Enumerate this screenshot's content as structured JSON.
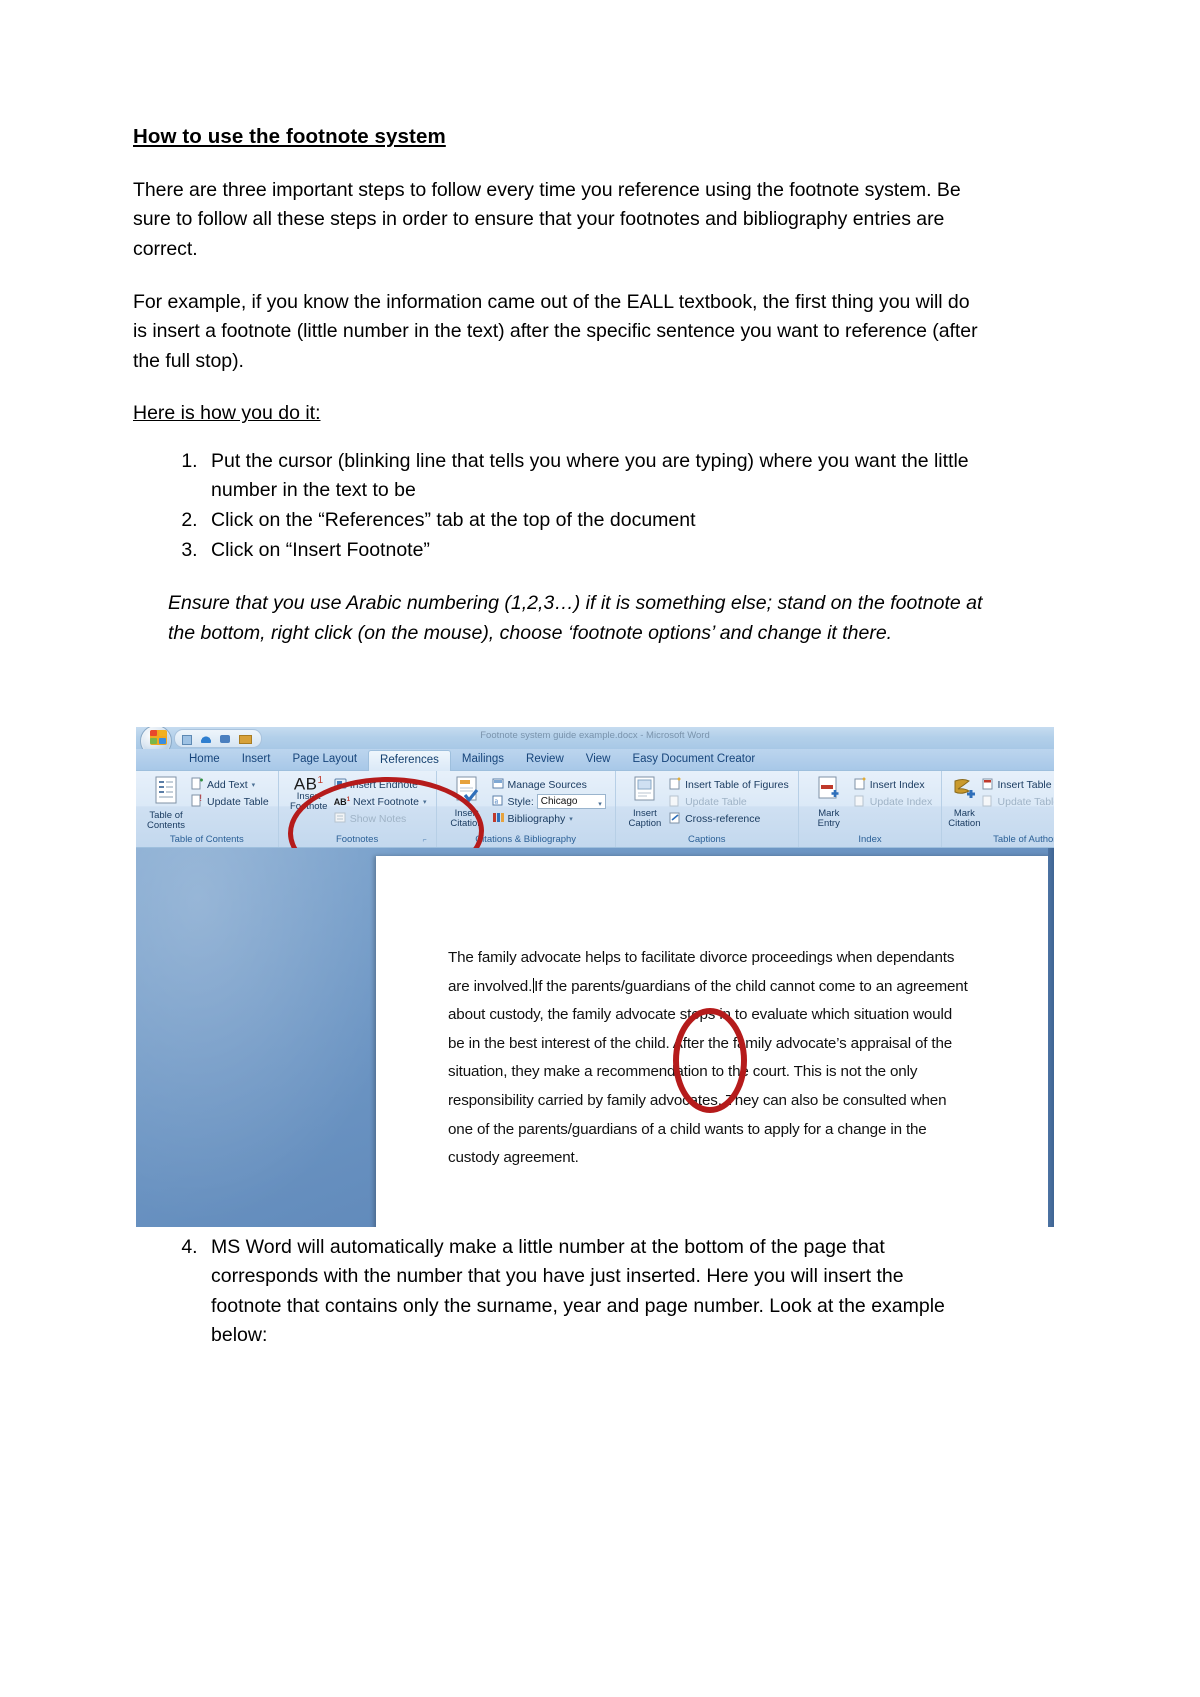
{
  "document": {
    "title": "How to use the footnote system",
    "paragraphs": [
      "There are three important steps to follow every time you reference using the footnote system. Be sure to follow all these steps in order to ensure that your footnotes and bibliography entries are correct.",
      "For example, if you know the information came out of the EALL textbook, the first thing you will do is insert a footnote (little number in the text) after the specific sentence you want to reference (after the full stop)."
    ],
    "lead_in": "Here is how you do it:",
    "steps": [
      "Put the cursor (blinking line that tells you where you are typing) where you want the little number in the text to be",
      "Click on the “References” tab at the top of the document",
      "Click on “Insert Footnote”"
    ],
    "italic_note": "Ensure that you use Arabic numbering (1,2,3…) if it is something else; stand on the footnote at the bottom, right click (on the mouse), choose ‘footnote options’ and change it there.",
    "steps_continued": [
      "MS Word will automatically make a little number at the bottom of the page that corresponds with the number that you have just inserted. Here you will insert the footnote that contains only the surname, year and page number. Look at the example below:"
    ]
  },
  "screenshot": {
    "window_title": "Footnote system guide example.docx - Microsoft Word",
    "office_button": "Office Button",
    "quick_access": [
      "save-icon",
      "undo-icon",
      "redo-icon",
      "customize-icon"
    ],
    "tabs": [
      {
        "label": "Home",
        "active": false
      },
      {
        "label": "Insert",
        "active": false
      },
      {
        "label": "Page Layout",
        "active": false
      },
      {
        "label": "References",
        "active": true
      },
      {
        "label": "Mailings",
        "active": false
      },
      {
        "label": "Review",
        "active": false
      },
      {
        "label": "View",
        "active": false
      },
      {
        "label": "Easy Document Creator",
        "active": false
      }
    ],
    "ribbon_groups": [
      {
        "label": "Table of Contents",
        "big_button": "Table of\nContents",
        "big_button_line1": "Table of",
        "big_button_line2": "Contents",
        "big_icon": "table-of-contents-icon",
        "items": [
          {
            "label": "Add Text",
            "icon": "add-text-icon",
            "caret": true,
            "disabled": false
          },
          {
            "label": "Update Table",
            "icon": "update-table-icon",
            "caret": false,
            "disabled": false
          }
        ]
      },
      {
        "label": "Footnotes",
        "big_button_line1": "Insert",
        "big_button_line2": "Footnote",
        "big_icon": "insert-footnote-icon",
        "big_glyph": "AB",
        "big_glyph_sup": "1",
        "has_dialog_launcher": true,
        "items": [
          {
            "label": "Insert Endnote",
            "icon": "insert-endnote-icon",
            "caret": false,
            "disabled": false
          },
          {
            "label": "Next Footnote",
            "icon": "next-footnote-icon",
            "caret": true,
            "disabled": false
          },
          {
            "label": "Show Notes",
            "icon": "show-notes-icon",
            "caret": false,
            "disabled": true
          }
        ]
      },
      {
        "label": "Citations & Bibliography",
        "big_button_line1": "Insert",
        "big_button_line2": "Citation",
        "big_icon": "insert-citation-icon",
        "big_caret": true,
        "items": [
          {
            "label": "Manage Sources",
            "icon": "manage-sources-icon",
            "caret": false,
            "disabled": false
          },
          {
            "label": "Style:",
            "icon": "style-icon",
            "value": "Chicago",
            "is_dropdown": true,
            "disabled": false
          },
          {
            "label": "Bibliography",
            "icon": "bibliography-icon",
            "caret": true,
            "disabled": false
          }
        ]
      },
      {
        "label": "Captions",
        "big_button_line1": "Insert",
        "big_button_line2": "Caption",
        "big_icon": "insert-caption-icon",
        "items": [
          {
            "label": "Insert Table of Figures",
            "icon": "insert-table-of-figures-icon",
            "caret": false,
            "disabled": false
          },
          {
            "label": "Update Table",
            "icon": "update-table-icon",
            "caret": false,
            "disabled": true
          },
          {
            "label": "Cross-reference",
            "icon": "cross-reference-icon",
            "caret": false,
            "disabled": false
          }
        ]
      },
      {
        "label": "Index",
        "big_button_line1": "Mark",
        "big_button_line2": "Entry",
        "big_icon": "mark-entry-icon",
        "items": [
          {
            "label": "Insert Index",
            "icon": "insert-index-icon",
            "caret": false,
            "disabled": false
          },
          {
            "label": "Update Index",
            "icon": "update-index-icon",
            "caret": false,
            "disabled": true
          }
        ]
      },
      {
        "label": "Table of Authorities",
        "big_button_line1": "Mark",
        "big_button_line2": "Citation",
        "big_icon": "mark-citation-icon",
        "items": [
          {
            "label": "Insert Table of Authorities",
            "icon": "insert-table-of-authorities-icon",
            "caret": false,
            "disabled": false
          },
          {
            "label": "Update Table",
            "icon": "update-table-icon",
            "caret": false,
            "disabled": true
          }
        ]
      }
    ],
    "page_text_before_caret": "The family advocate helps to facilitate divorce proceedings when dependants are involved.",
    "page_text_after_caret": "If the parents/guardians of the child cannot come to an agreement about custody, the family advocate steps in to evaluate which situation would be in the best interest of the child. After the family advocate’s appraisal of the situation, they make a recommendation to the court. This is not the only responsibility carried by family advocates. They can also be consulted when one of the parents/guardians of a child wants to apply for a change in the custody agreement.",
    "annotations": [
      {
        "name": "ribbon-footnotes-highlight",
        "shape": "ellipse",
        "color": "#b51b1b"
      },
      {
        "name": "cursor-position-highlight",
        "shape": "ellipse",
        "color": "#b51b1b"
      }
    ]
  },
  "colors": {
    "annotation_red": "#b51b1b",
    "ribbon_blue": "#c3d8ee",
    "canvas_blue": "#6d96c4",
    "tab_text": "#16447a"
  }
}
